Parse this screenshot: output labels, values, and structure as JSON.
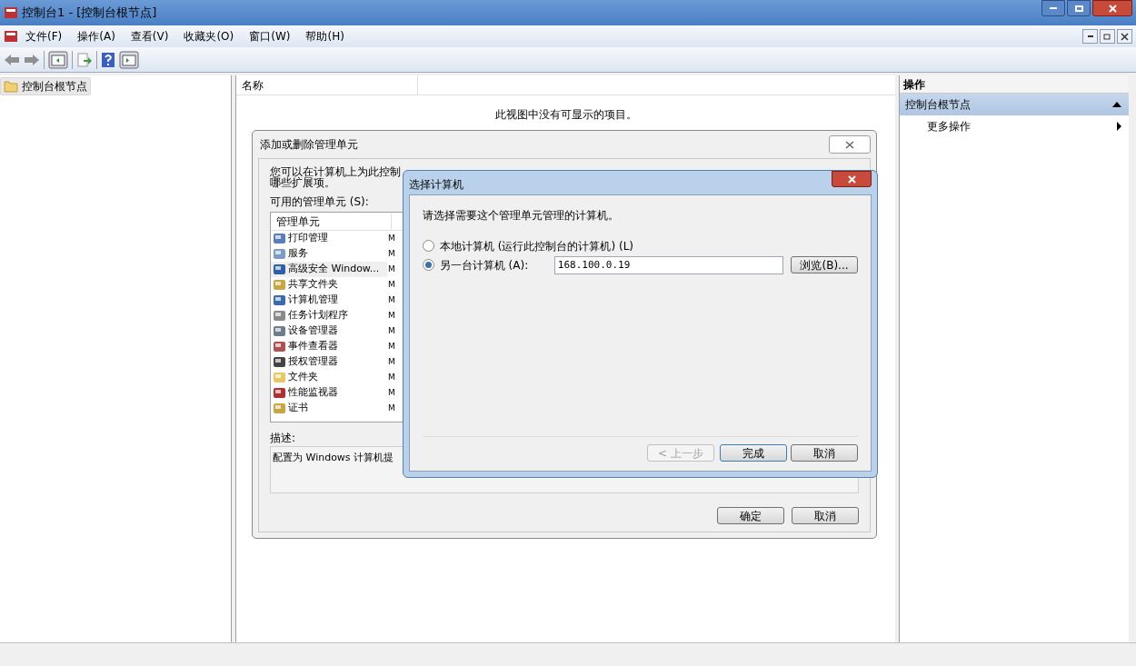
{
  "window": {
    "title": "控制台1 - [控制台根节点]"
  },
  "menu": [
    "文件(F)",
    "操作(A)",
    "查看(V)",
    "收藏夹(O)",
    "窗口(W)",
    "帮助(H)"
  ],
  "tree": {
    "items": [
      {
        "label": "控制台根节点",
        "selected": true
      }
    ]
  },
  "list": {
    "columns": [
      "名称"
    ],
    "empty_message": "此视图中没有可显示的项目。"
  },
  "actions": {
    "title": "操作",
    "section": "控制台根节点",
    "items": [
      "更多操作"
    ]
  },
  "add_remove_dialog": {
    "title": "添加或删除管理单元",
    "intro_line1": "您可以在计算机上为此控制",
    "intro_line2": "哪些扩展项。",
    "available_label": "可用的管理单元 (S):",
    "columns": [
      "管理单元"
    ],
    "snapins": [
      {
        "name": "打印管理",
        "vendor": "M",
        "selected": false
      },
      {
        "name": "服务",
        "vendor": "M",
        "selected": false
      },
      {
        "name": "高级安全 Window...",
        "vendor": "M",
        "selected": true
      },
      {
        "name": "共享文件夹",
        "vendor": "M",
        "selected": false
      },
      {
        "name": "计算机管理",
        "vendor": "M",
        "selected": false
      },
      {
        "name": "任务计划程序",
        "vendor": "M",
        "selected": false
      },
      {
        "name": "设备管理器",
        "vendor": "M",
        "selected": false
      },
      {
        "name": "事件查看器",
        "vendor": "M",
        "selected": false
      },
      {
        "name": "授权管理器",
        "vendor": "M",
        "selected": false
      },
      {
        "name": "文件夹",
        "vendor": "M",
        "selected": false
      },
      {
        "name": "性能监视器",
        "vendor": "M",
        "selected": false
      },
      {
        "name": "证书",
        "vendor": "M",
        "selected": false
      }
    ],
    "description_label": "描述:",
    "description": "配置为 Windows 计算机提",
    "buttons": [
      "确定",
      "取消"
    ]
  },
  "select_computer_dialog": {
    "title": "选择计算机",
    "prompt": "请选择需要这个管理单元管理的计算机。",
    "options": [
      {
        "label": "本地计算机 (运行此控制台的计算机) (L)",
        "selected": false
      },
      {
        "label": "另一台计算机 (A):",
        "selected": true
      }
    ],
    "computer_name": "168.100.0.19",
    "browse_button": "浏览(B)...",
    "buttons": [
      {
        "label": "< 上一步",
        "disabled": true,
        "default": false
      },
      {
        "label": "完成",
        "disabled": false,
        "default": true
      },
      {
        "label": "取消",
        "disabled": false,
        "default": false
      }
    ]
  }
}
